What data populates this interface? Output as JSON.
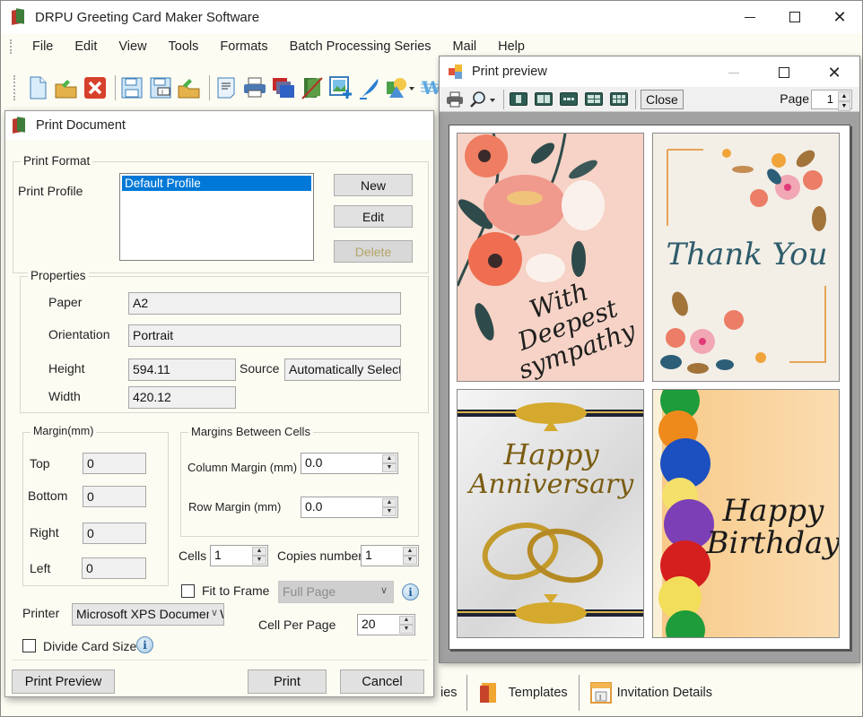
{
  "app": {
    "title": "DRPU Greeting Card Maker Software",
    "menu": [
      "File",
      "Edit",
      "View",
      "Tools",
      "Formats",
      "Batch Processing Series",
      "Mail",
      "Help"
    ],
    "toolbar_icons": [
      "new-document-icon",
      "open-folder-icon",
      "close-document-icon",
      "save-icon",
      "save-as-icon",
      "export-folder-icon",
      "properties-icon",
      "print-icon",
      "layers-icon",
      "card-design-icon",
      "insert-image-icon",
      "signature-pen-icon",
      "shapes-icon",
      "word-art-icon"
    ],
    "bottom_tabs": {
      "partial_label": "ies",
      "templates": "Templates",
      "invitation_details": "Invitation Details"
    }
  },
  "print_document": {
    "title": "Print Document",
    "print_format": {
      "group_label": "Print Format",
      "profile_label": "Print Profile",
      "profiles": [
        "Default Profile"
      ],
      "selected_profile": "Default Profile",
      "new_label": "New",
      "edit_label": "Edit",
      "delete_label": "Delete"
    },
    "properties": {
      "group_label": "Properties",
      "paper_label": "Paper",
      "paper_value": "A2",
      "orientation_label": "Orientation",
      "orientation_value": "Portrait",
      "height_label": "Height",
      "height_value": "594.11",
      "source_label": "Source",
      "source_value": "Automatically Select",
      "width_label": "Width",
      "width_value": "420.12"
    },
    "margin": {
      "group_label": "Margin(mm)",
      "top_label": "Top",
      "top_value": "0",
      "bottom_label": "Bottom",
      "bottom_value": "0",
      "right_label": "Right",
      "right_value": "0",
      "left_label": "Left",
      "left_value": "0"
    },
    "cell_margins": {
      "group_label": "Margins Between Cells",
      "column_label": "Column Margin (mm)",
      "column_value": "0.0",
      "row_label": "Row Margin (mm)",
      "row_value": "0.0"
    },
    "cells_label": "Cells",
    "cells_value": "1",
    "copies_label": "Copies number",
    "copies_value": "1",
    "fit_to_frame_label": "Fit to Frame",
    "fit_to_frame_checked": false,
    "frame_mode_value": "Full Page",
    "printer_label": "Printer",
    "printer_value": "Microsoft XPS Document Writer",
    "cell_per_page_label": "Cell Per Page",
    "cell_per_page_value": "20",
    "divide_card_label": "Divide Card Size",
    "divide_card_checked": false,
    "print_preview_label": "Print Preview",
    "print_label": "Print",
    "cancel_label": "Cancel"
  },
  "print_preview": {
    "title": "Print preview",
    "close_label": "Close",
    "page_label": "Page",
    "page_value": "1",
    "cards": [
      {
        "text_line1": "With Deepest",
        "text_line2": "sympathy",
        "bg": "#f6d3c6",
        "color": "#1e1e1e"
      },
      {
        "text_line1": "Thank You",
        "text_line2": "",
        "bg": "#f3efe7",
        "color": "#2f5c6b"
      },
      {
        "text_line1": "Happy",
        "text_line2": "Anniversary",
        "bg": "#e7e7e7",
        "color": "#7a5c12"
      },
      {
        "text_line1": "Happy",
        "text_line2": "Birthday",
        "bg": "#fbd9a6",
        "color": "#1a1a1a"
      }
    ]
  },
  "colors": {
    "selection": "#0078d7",
    "dialog_bg": "#fdfcf3",
    "preview_bg": "#a0a0a0"
  }
}
